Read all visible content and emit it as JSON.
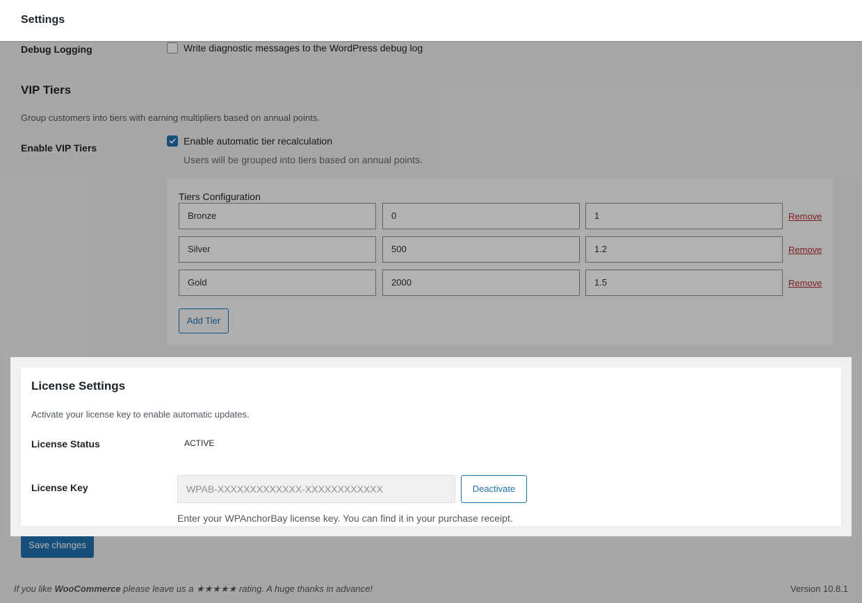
{
  "header": {
    "title": "Settings"
  },
  "debug": {
    "label": "Debug Logging",
    "checkbox_label": "Write diagnostic messages to the WordPress debug log",
    "checked": false
  },
  "vip": {
    "title": "VIP Tiers",
    "description": "Group customers into tiers with earning multipliers based on annual points.",
    "enable_label": "Enable VIP Tiers",
    "checkbox_label": "Enable automatic tier recalculation",
    "checked": true,
    "help": "Users will be grouped into tiers based on annual points.",
    "tiers_title": "Tiers Configuration",
    "tiers": [
      {
        "name": "Bronze",
        "points": "0",
        "multiplier": "1",
        "remove": "Remove"
      },
      {
        "name": "Silver",
        "points": "500",
        "multiplier": "1.2",
        "remove": "Remove"
      },
      {
        "name": "Gold",
        "points": "2000",
        "multiplier": "1.5",
        "remove": "Remove"
      }
    ],
    "add_tier": "Add Tier"
  },
  "license": {
    "title": "License Settings",
    "description": "Activate your license key to enable automatic updates.",
    "status_label": "License Status",
    "status_value": "ACTIVE",
    "key_label": "License Key",
    "key_value": "WPAB-XXXXXXXXXXXXX-XXXXXXXXXXXX",
    "deactivate": "Deactivate",
    "key_help": "Enter your WPAnchorBay license key. You can find it in your purchase receipt."
  },
  "save_button": "Save changes",
  "footer": {
    "rating_prefix": "If you like ",
    "rating_brand": "WooCommerce",
    "rating_suffix": " please leave us a ★★★★★ rating. A huge thanks in advance!",
    "version": "Version 10.8.1"
  },
  "colors": {
    "accent": "#2271b1",
    "danger": "#b32d2e",
    "overlay": "rgba(0,0,0,0.30)"
  }
}
